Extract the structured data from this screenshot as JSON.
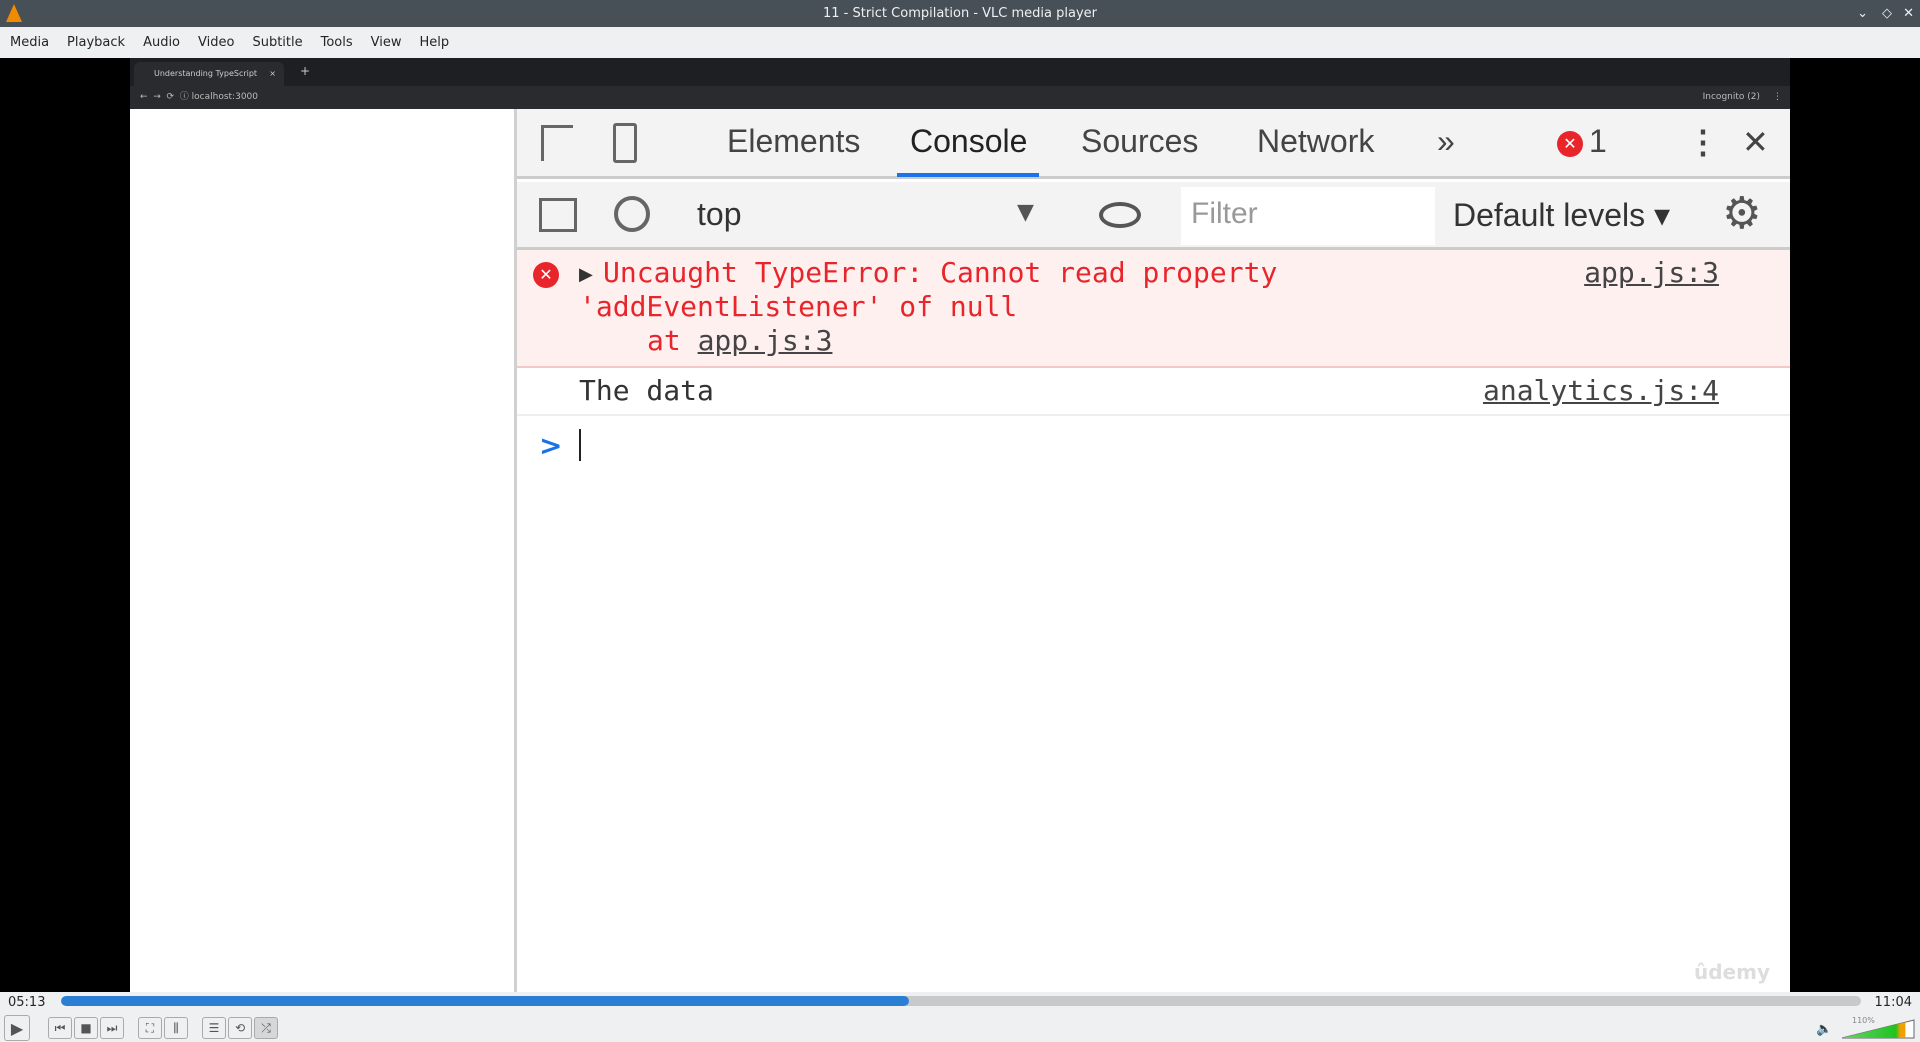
{
  "window": {
    "title": "11 - Strict Compilation - VLC media player"
  },
  "menu": [
    "Media",
    "Playback",
    "Audio",
    "Video",
    "Subtitle",
    "Tools",
    "View",
    "Help"
  ],
  "browser": {
    "tab_title": "Understanding TypeScript",
    "url": "localhost:3000",
    "profile": "Incognito (2)"
  },
  "devtools": {
    "tabs": [
      "Elements",
      "Console",
      "Sources",
      "Network"
    ],
    "active_tab": "Console",
    "error_count": "1",
    "context": "top",
    "filter_placeholder": "Filter",
    "levels": "Default levels",
    "messages": [
      {
        "type": "error",
        "line1": "Uncaught TypeError: Cannot read property",
        "line2": "'addEventListener' of null",
        "at": "at",
        "at_link": "app.js:3",
        "source": "app.js:3"
      },
      {
        "type": "log",
        "text": "The data",
        "source": "analytics.js:4"
      }
    ],
    "prompt": ">"
  },
  "watermark": "ûdemy",
  "player": {
    "elapsed": "05:13",
    "total": "11:04",
    "progress_percent": 47.1,
    "volume": "110%",
    "volume_level": 1.1,
    "accent": "#2a7fd4"
  }
}
